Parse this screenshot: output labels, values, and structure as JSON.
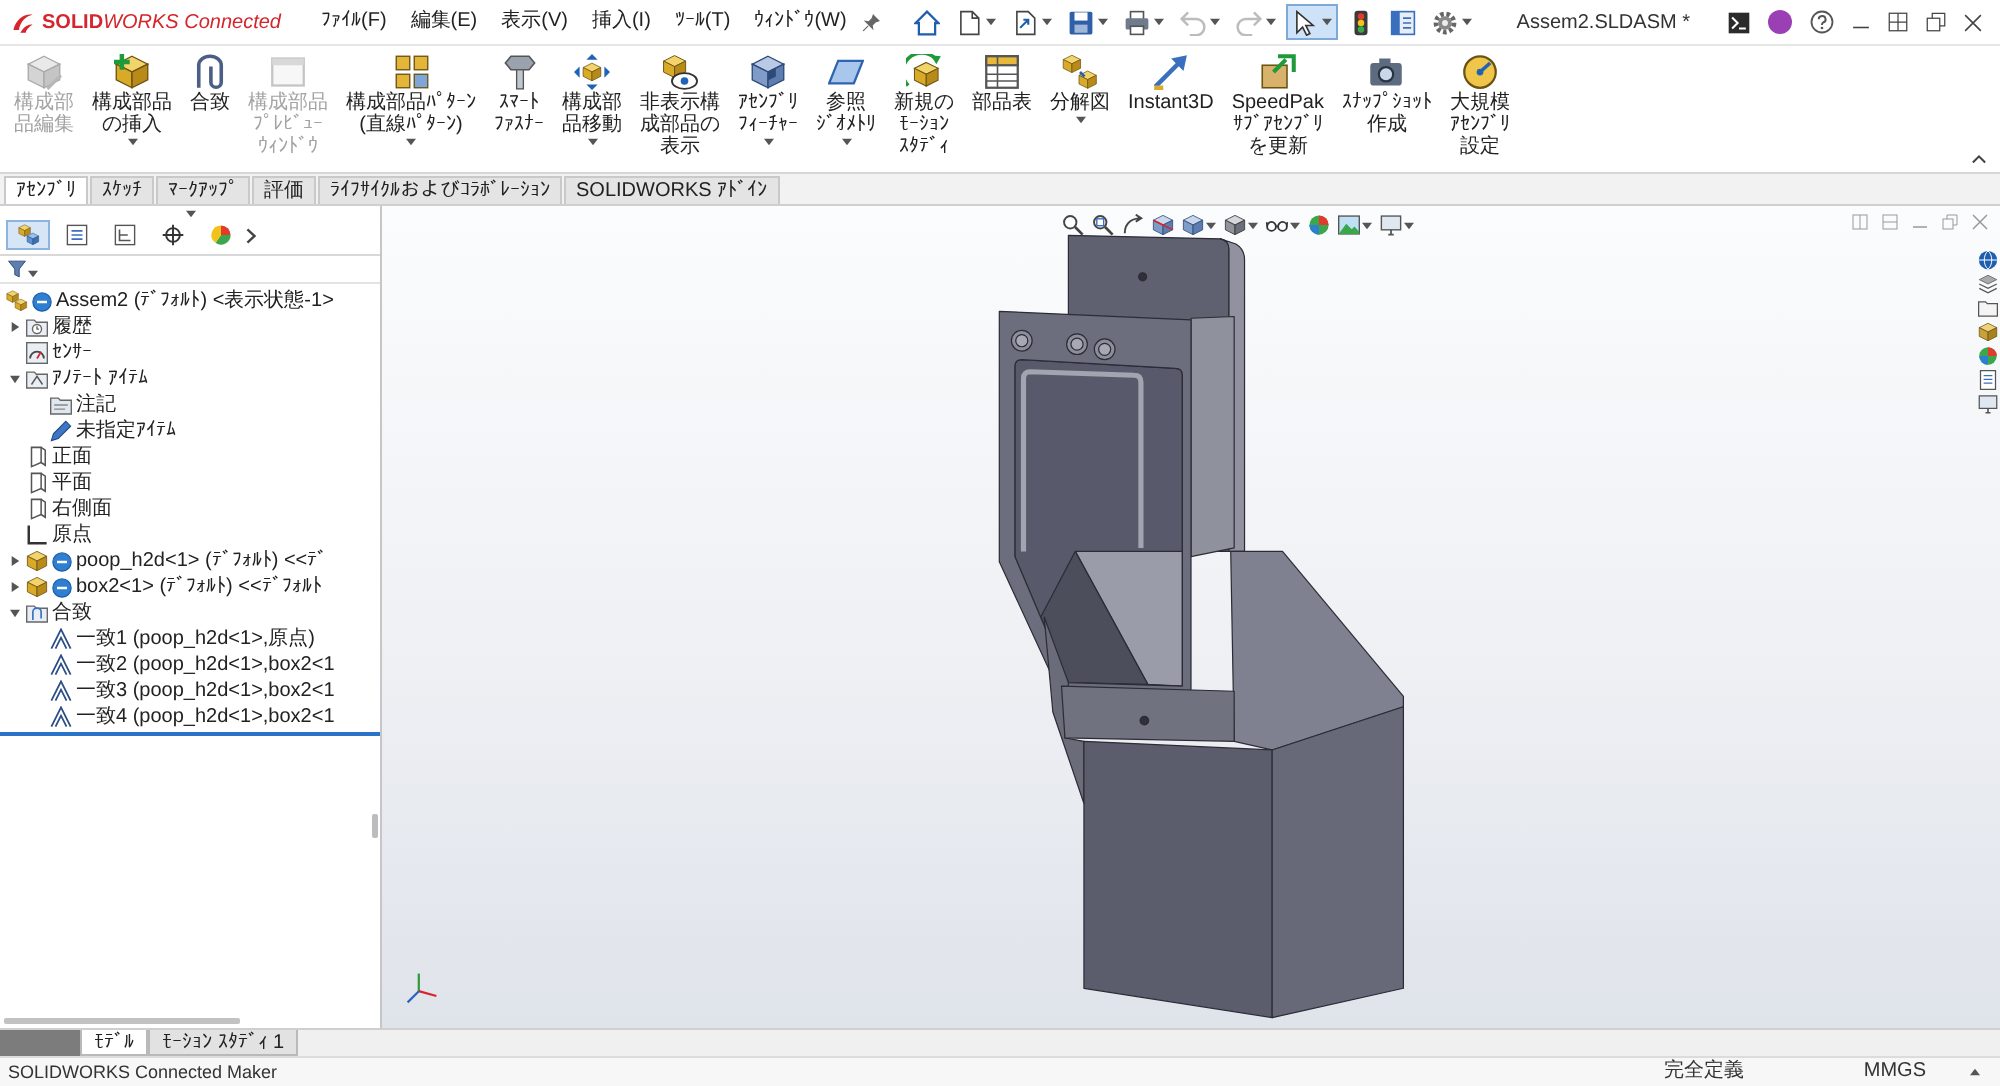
{
  "app": {
    "logo_text": "**SOLID**WORKS Connected"
  },
  "menu": [
    "ﾌｧｲﾙ(F)",
    "編集(E)",
    "表示(V)",
    "挿入(I)",
    "ﾂｰﾙ(T)",
    "ｳｨﾝﾄﾞｳ(W)"
  ],
  "quick_access_toolbar": [
    {
      "dropdown": false,
      "disabled": false,
      "selected": false
    },
    {
      "dropdown": true,
      "disabled": false,
      "selected": false
    },
    {
      "dropdown": true,
      "disabled": false,
      "selected": false
    },
    {
      "dropdown": true,
      "disabled": false,
      "selected": false
    },
    {
      "dropdown": true,
      "disabled": false,
      "selected": false
    },
    {
      "dropdown": true,
      "disabled": true,
      "selected": false
    },
    {
      "dropdown": true,
      "disabled": true,
      "selected": false
    },
    {
      "dropdown": true,
      "disabled": false,
      "selected": true
    },
    {
      "dropdown": false,
      "disabled": false,
      "selected": false
    },
    {
      "dropdown": false,
      "disabled": false,
      "selected": false
    },
    {
      "dropdown": true,
      "disabled": false,
      "selected": false
    }
  ],
  "window": {
    "title": "Assem2.SLDASM *"
  },
  "ribbon": {
    "buttons": [
      {
        "label": "構成部品編集",
        "disabled": true,
        "dropdown": false
      },
      {
        "label": "構成部品の挿入",
        "disabled": false,
        "dropdown": true
      },
      {
        "label": "合致",
        "disabled": false,
        "dropdown": false
      },
      {
        "label": "構成部品ﾌﾟﾚﾋﾞｭｰｳｨﾝﾄﾞｳ",
        "disabled": true,
        "dropdown": false
      },
      {
        "label": "構成部品ﾊﾟﾀｰﾝ (直線ﾊﾟﾀｰﾝ)",
        "disabled": false,
        "dropdown": true
      },
      {
        "label": "ｽﾏｰﾄﾌｧｽﾅｰ",
        "disabled": false,
        "dropdown": false
      },
      {
        "label": "構成部品移動",
        "disabled": false,
        "dropdown": true
      },
      {
        "label": "非表示構成部品の表示",
        "disabled": false,
        "dropdown": false
      },
      {
        "label": "ｱｾﾝﾌﾞﾘﾌｨｰﾁｬｰ",
        "disabled": false,
        "dropdown": true
      },
      {
        "label": "参照ｼﾞｵﾒﾄﾘ",
        "disabled": false,
        "dropdown": true
      },
      {
        "label": "新規のﾓｰｼｮﾝｽﾀﾃﾞｨ",
        "disabled": false,
        "dropdown": false
      },
      {
        "label": "部品表",
        "disabled": false,
        "dropdown": false
      },
      {
        "label": "分解図",
        "disabled": false,
        "dropdown": true
      },
      {
        "label": "Instant3D",
        "disabled": false,
        "dropdown": false
      },
      {
        "label": "SpeedPak ｻﾌﾞｱｾﾝﾌﾞﾘを更新",
        "disabled": false,
        "dropdown": false
      },
      {
        "label": "ｽﾅｯﾌﾟｼｮｯﾄ作成",
        "disabled": false,
        "dropdown": false
      },
      {
        "label": "大規模ｱｾﾝﾌﾞﾘ設定",
        "disabled": false,
        "dropdown": false
      }
    ],
    "tabs": [
      {
        "label": "ｱｾﾝﾌﾞﾘ",
        "selected": true
      },
      {
        "label": "ｽｹｯﾁ",
        "selected": false
      },
      {
        "label": "ﾏｰｸｱｯﾌﾟ",
        "selected": false
      },
      {
        "label": "評価",
        "selected": false
      },
      {
        "label": "ﾗｲﾌｻｲｸﾙおよびｺﾗﾎﾞﾚｰｼｮﾝ",
        "selected": false
      },
      {
        "label": "SOLIDWORKS ｱﾄﾞｲﾝ",
        "selected": false
      }
    ]
  },
  "feature_manager": {
    "tabs": [
      {
        "selected": true
      },
      {
        "selected": false
      },
      {
        "selected": false
      },
      {
        "selected": false
      },
      {
        "selected": false
      }
    ],
    "tree": [
      {
        "kind": "assembly",
        "label": "Assem2 (ﾃﾞﾌｫﾙﾄ) <表示状態-1>",
        "children": [
          {
            "kind": "history",
            "label": "履歴",
            "expanded": false
          },
          {
            "kind": "sensor",
            "label": "ｾﾝｻｰ"
          },
          {
            "kind": "annotations",
            "label": "ｱﾉﾃｰﾄ ｱｲﾃﾑ",
            "expanded": true,
            "children": [
              {
                "kind": "note",
                "label": "注記"
              },
              {
                "kind": "unassigned",
                "label": "未指定ｱｲﾃﾑ"
              }
            ]
          },
          {
            "kind": "plane",
            "label": "正面"
          },
          {
            "kind": "plane",
            "label": "平面"
          },
          {
            "kind": "plane",
            "label": "右側面"
          },
          {
            "kind": "origin",
            "label": "原点"
          },
          {
            "kind": "part",
            "label": "poop_h2d<1> (ﾃﾞﾌｫﾙﾄ) <<ﾃﾞ",
            "expanded": false
          },
          {
            "kind": "part",
            "label": "box2<1> (ﾃﾞﾌｫﾙﾄ) <<ﾃﾞﾌｫﾙﾄ",
            "expanded": false
          },
          {
            "kind": "mates",
            "label": "合致",
            "expanded": true,
            "children": [
              {
                "kind": "mate",
                "label": "一致1 (poop_h2d<1>,原点)"
              },
              {
                "kind": "mate",
                "label": "一致2 (poop_h2d<1>,box2<1"
              },
              {
                "kind": "mate",
                "label": "一致3 (poop_h2d<1>,box2<1"
              },
              {
                "kind": "mate",
                "label": "一致4 (poop_h2d<1>,box2<1"
              }
            ]
          }
        ]
      }
    ]
  },
  "bottom_tabs": [
    {
      "label": "ﾓﾃﾞﾙ",
      "selected": true
    },
    {
      "label": "ﾓｰｼｮﾝ ｽﾀﾃﾞｨ 1",
      "selected": false
    }
  ],
  "status_bar": {
    "product": "SOLIDWORKS Connected Maker",
    "state": "完全定義",
    "units": "MMGS"
  }
}
